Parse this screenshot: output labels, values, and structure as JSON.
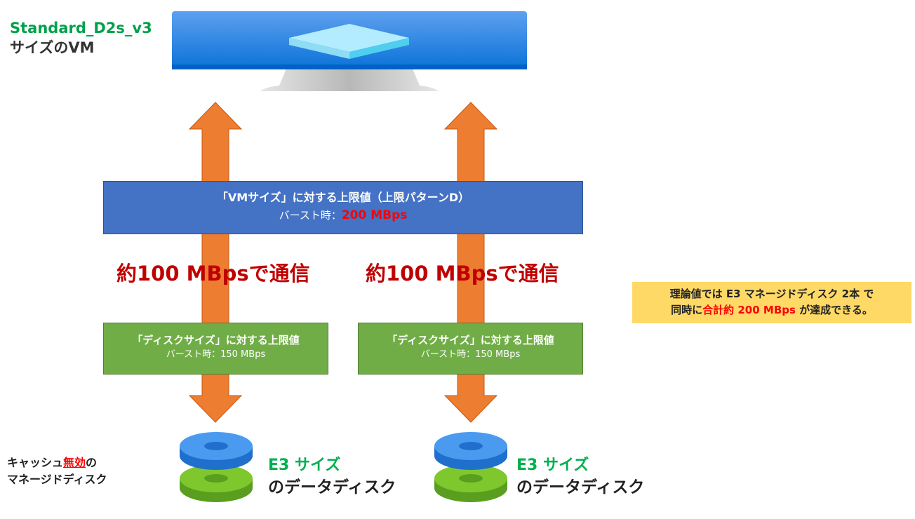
{
  "vm": {
    "sku": "Standard_D2s_v3",
    "desc": "サイズのVM"
  },
  "vm_limit": {
    "title": "「VMサイズ」に対する上限値（上限パターンD）",
    "burst_prefix": "バースト時：",
    "burst_value": "200 MBps"
  },
  "comm_left": "約100 MBpsで通信",
  "comm_right": "約100 MBpsで通信",
  "disk_limit_left": {
    "title": "「ディスクサイズ」に対する上限値",
    "burst": "バースト時：150 MBps"
  },
  "disk_limit_right": {
    "title": "「ディスクサイズ」に対する上限値",
    "burst": "バースト時：150 MBps"
  },
  "note": {
    "line1": "理論値では E3 マネージドディスク 2本 で",
    "line2_prefix": "同時に",
    "line2_red": "合計約 200 MBps",
    "line2_suffix": "が達成できる。"
  },
  "cache_label": {
    "line1_prefix": "キャッシュ",
    "line1_red": "無効",
    "line1_suffix": "の",
    "line2": "マネージドディスク"
  },
  "disk_left": {
    "size": "E3 サイズ",
    "desc": "のデータディスク"
  },
  "disk_right": {
    "size": "E3 サイズ",
    "desc": "のデータディスク"
  },
  "colors": {
    "arrow": "#ed7d31",
    "vm_limit_box": "#4472c4",
    "disk_limit_box": "#70ad47",
    "note_bg": "#ffd966",
    "highlight_red": "#ff0000",
    "comm_text": "#c00000",
    "sku_green": "#00a14b",
    "disk_size_green": "#00b050"
  }
}
